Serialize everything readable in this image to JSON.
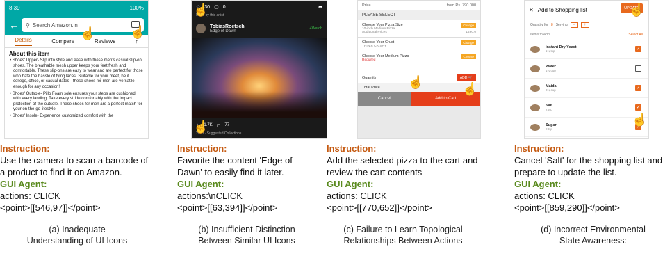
{
  "panels": [
    {
      "instruction_label": "Instruction:",
      "instruction": "Use the camera to scan a barcode of a product to find it on Amazon.",
      "agent_label": "GUI Agent:",
      "actions": "actions: CLICK",
      "point": "<point>[[546,97]]</point>",
      "caption_line1": "(a) Inadequate",
      "caption_line2": "Understanding of UI Icons",
      "screen": {
        "time": "8:39",
        "battery": "100%",
        "search_placeholder": "Search Amazon.in",
        "tabs": [
          "Details",
          "Compare",
          "Reviews"
        ],
        "about_heading": "About this item",
        "bullets": [
          "Shoes' Upper- Slip into style and ease with these men's casual slip-on shoes. The breathable mesh upper keeps your feet fresh and comfortable. These slip-ons are easy to wear and are perfect for those who hate the hassle of tying laces. Suitable for your meet, be it college, office, or casual dates - these shoes for men are versatile enough for any occasion!",
          "Shoes' Outsole- Pillo Foam sole ensures your steps are cushioned with every landing. Take every stride comfortably with the impact protection of the outsole. These shoes for men are a perfect match for your on-the-go lifestyle.",
          "Shoes' Insole- Experience customized comfort with the"
        ]
      }
    },
    {
      "instruction_label": "Instruction:",
      "instruction": "Favorite the content 'Edge of Dawn' to easily find it later.",
      "agent_label": "GUI Agent:",
      "actions": "actions:\\nCLICK",
      "point": "<point>[[63,394]]</point>",
      "caption_line1": "(b) Insufficient Distinction",
      "caption_line2": "Between Similar UI Icons",
      "screen": {
        "stars": "30",
        "comments": "0",
        "muse_text": "Muse by this artist",
        "artist": "TobiasRoetsch",
        "title": "Edge of Dawn",
        "follow": "+Watch",
        "bottom_likes": "1.7K",
        "bottom_comments": "77",
        "date": "2020 · Suggested Collections"
      }
    },
    {
      "instruction_label": "Instruction:",
      "instruction": "Add the selected pizza to the cart and review the cart contents",
      "agent_label": "GUI Agent:",
      "actions": "actions: CLICK",
      "point": "<point>[[770,652]]</point>",
      "caption_line1": "(c) Failure to Learn Topological",
      "caption_line2": "Relationships Between Actions",
      "screen": {
        "price_label": "Price",
        "price_value": "from Rs. 790.000",
        "select_heading": "PLEASE SELECT",
        "size_label": "Choose Your Pizza Size",
        "size_sub": "10-inch Medium Pizza",
        "size_extra": "Additional Prices",
        "size_price": "1490.0",
        "crust_label": "Choose Your Crust",
        "crust_sub": "THIN & CRISPY",
        "medium_label": "Choose Your Medium Pizza",
        "required": "Required",
        "change": "Change",
        "choose": "Choose",
        "quantity": "Quantity",
        "add": "ADD",
        "total": "Total Price",
        "cancel": "Cancel",
        "add_to_cart": "Add to Cart"
      }
    },
    {
      "instruction_label": "Instruction:",
      "instruction": "Cancel 'Salt' for the shopping list and prepare to update the list.",
      "agent_label": "GUI Agent:",
      "actions": "actions: CLICK",
      "point": "<point>[[859,290]]</point>",
      "caption_line1": "(d) Incorrect Environmental",
      "caption_line2": "State Awareness:",
      "screen": {
        "title": "Add to Shopping list",
        "update": "UPDATE",
        "qty_label": "Quantity for",
        "qty_value": "8",
        "qty_unit": "Serving",
        "items_label": "Items to Add",
        "select_all": "Select All",
        "items": [
          {
            "name": "Instant Dry Yeast",
            "amount": "1¼ tsp",
            "checked": true
          },
          {
            "name": "Water",
            "amount": "1¼ cup",
            "checked": false
          },
          {
            "name": "Maida",
            "amount": "3¾ cup",
            "checked": true
          },
          {
            "name": "Salt",
            "amount": "2 tsp",
            "checked": true
          },
          {
            "name": "Sugar",
            "amount": "2 tsp",
            "checked": true
          }
        ]
      }
    }
  ]
}
